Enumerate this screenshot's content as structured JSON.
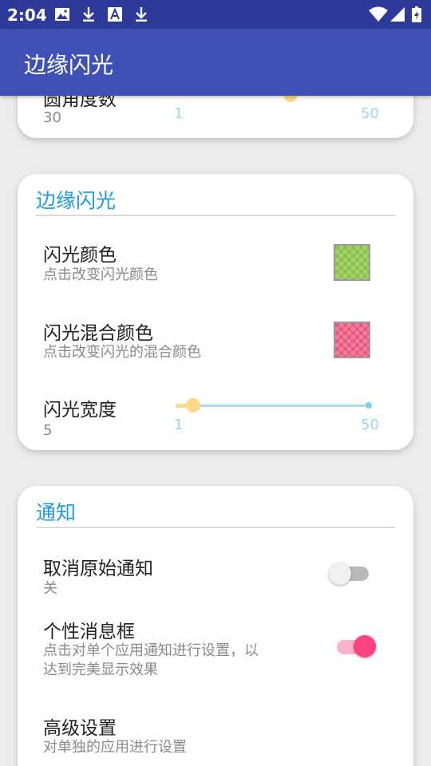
{
  "status_bar": {
    "time": "2:04",
    "icons": [
      "image-icon",
      "download-icon",
      "font-a-icon",
      "download-icon",
      "wifi-icon",
      "cell-signal-icon",
      "battery-icon"
    ]
  },
  "app_bar": {
    "title": "边缘闪光"
  },
  "top_card": {
    "row_title": "圆角度数",
    "value": "30",
    "slider": {
      "min_label": "1",
      "max_label": "50"
    }
  },
  "edge_card": {
    "header": "边缘闪光",
    "flash_color": {
      "title": "闪光颜色",
      "subtitle": "点击改变闪光颜色",
      "swatch_color": "#8bc34a"
    },
    "mix_color": {
      "title": "闪光混合颜色",
      "subtitle": "点击改变闪光的混合颜色",
      "swatch_color": "#ec5a82"
    },
    "flash_width": {
      "title": "闪光宽度",
      "value": "5",
      "slider": {
        "min_label": "1",
        "max_label": "50",
        "fraction": 0.08
      }
    }
  },
  "notify_card": {
    "header": "通知",
    "cancel_original": {
      "title": "取消原始通知",
      "subtitle": "关",
      "enabled": false
    },
    "custom_box": {
      "title": "个性消息框",
      "subtitle_line1": "点击对单个应用通知进行设置，以",
      "subtitle_line2": "达到完美显示效果",
      "enabled": true
    },
    "advanced": {
      "title": "高级设置",
      "subtitle": "对单独的应用进行设置"
    }
  },
  "colors": {
    "app_bar": "#3f51b5",
    "status_bar": "#2e3a99",
    "accent_header": "#1e9be8",
    "switch_on": "#ff4081",
    "slider_thumb": "#ffd98a",
    "slider_track": "#a6dff2"
  }
}
